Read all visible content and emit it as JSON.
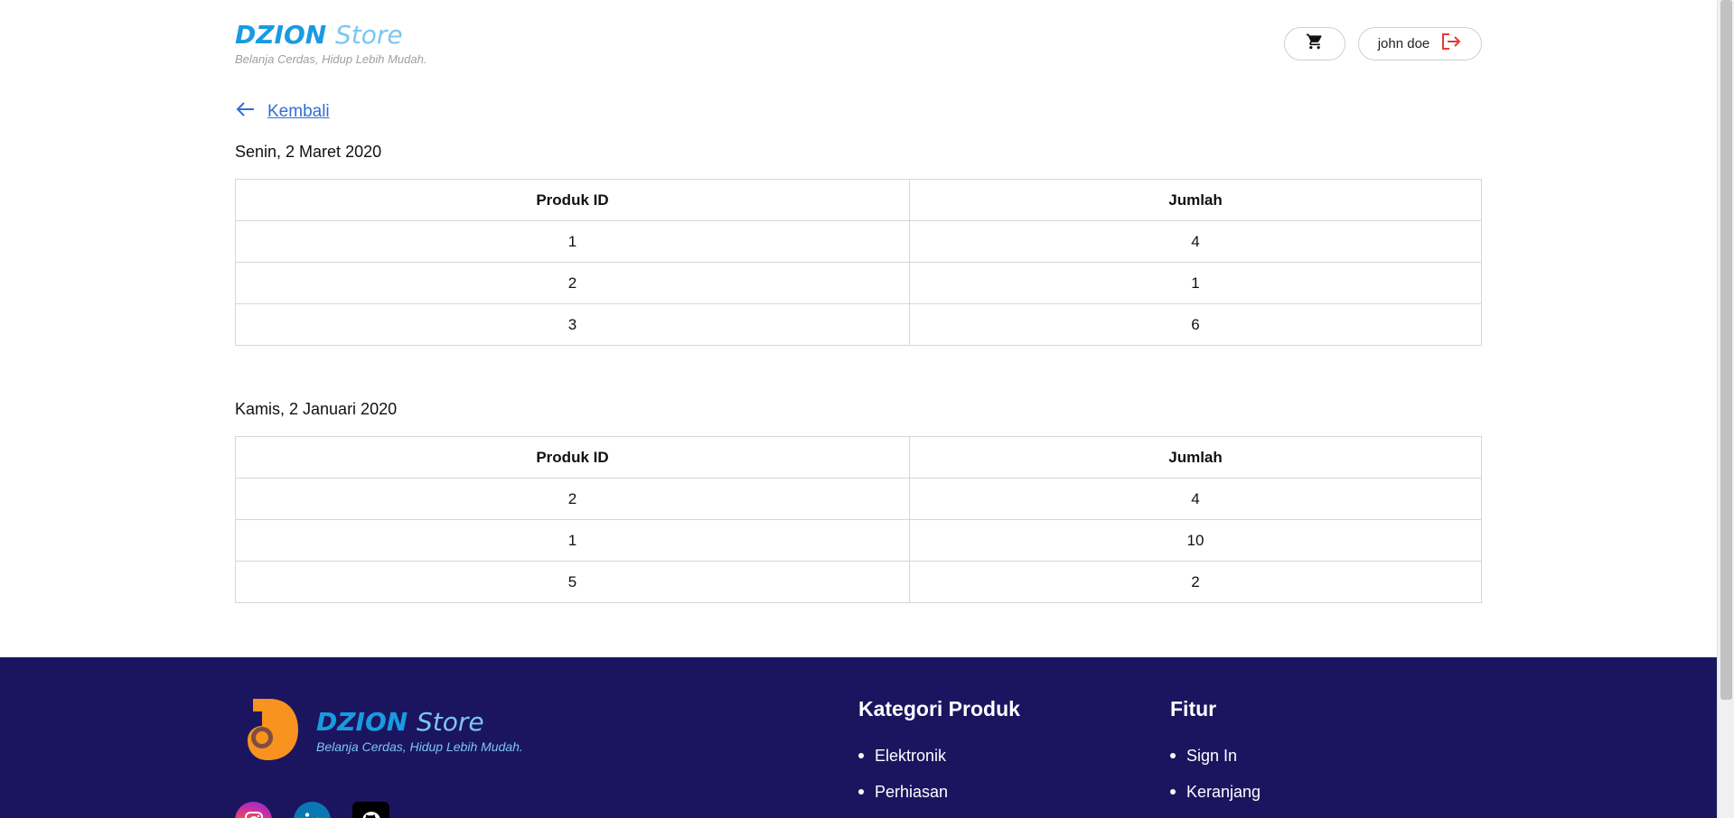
{
  "header": {
    "brand_word1": "DZION",
    "brand_word2": "Store",
    "tagline": "Belanja Cerdas, Hidup Lebih Mudah.",
    "user_name": "john doe"
  },
  "back_link": {
    "label": "Kembali"
  },
  "orders": [
    {
      "date": "Senin, 2 Maret 2020",
      "columns": [
        "Produk ID",
        "Jumlah"
      ],
      "rows": [
        [
          "1",
          "4"
        ],
        [
          "2",
          "1"
        ],
        [
          "3",
          "6"
        ]
      ]
    },
    {
      "date": "Kamis, 2 Januari 2020",
      "columns": [
        "Produk ID",
        "Jumlah"
      ],
      "rows": [
        [
          "2",
          "4"
        ],
        [
          "1",
          "10"
        ],
        [
          "5",
          "2"
        ]
      ]
    }
  ],
  "footer": {
    "brand_word1": "DZION",
    "brand_word2": "Store",
    "tagline": "Belanja Cerdas, Hidup Lebih Mudah.",
    "categories": {
      "title": "Kategori Produk",
      "items": [
        "Elektronik",
        "Perhiasan"
      ]
    },
    "features": {
      "title": "Fitur",
      "items": [
        "Sign In",
        "Keranjang"
      ]
    },
    "socials": [
      "instagram-icon",
      "linkedin-icon",
      "github-icon"
    ]
  },
  "colors": {
    "brand_primary": "#1a9be0",
    "brand_secondary": "#7cc6f2",
    "footer_bg": "#1b1560",
    "link": "#2f6fd6",
    "logout_accent": "#e53935",
    "logo_orange": "#f7931e"
  }
}
